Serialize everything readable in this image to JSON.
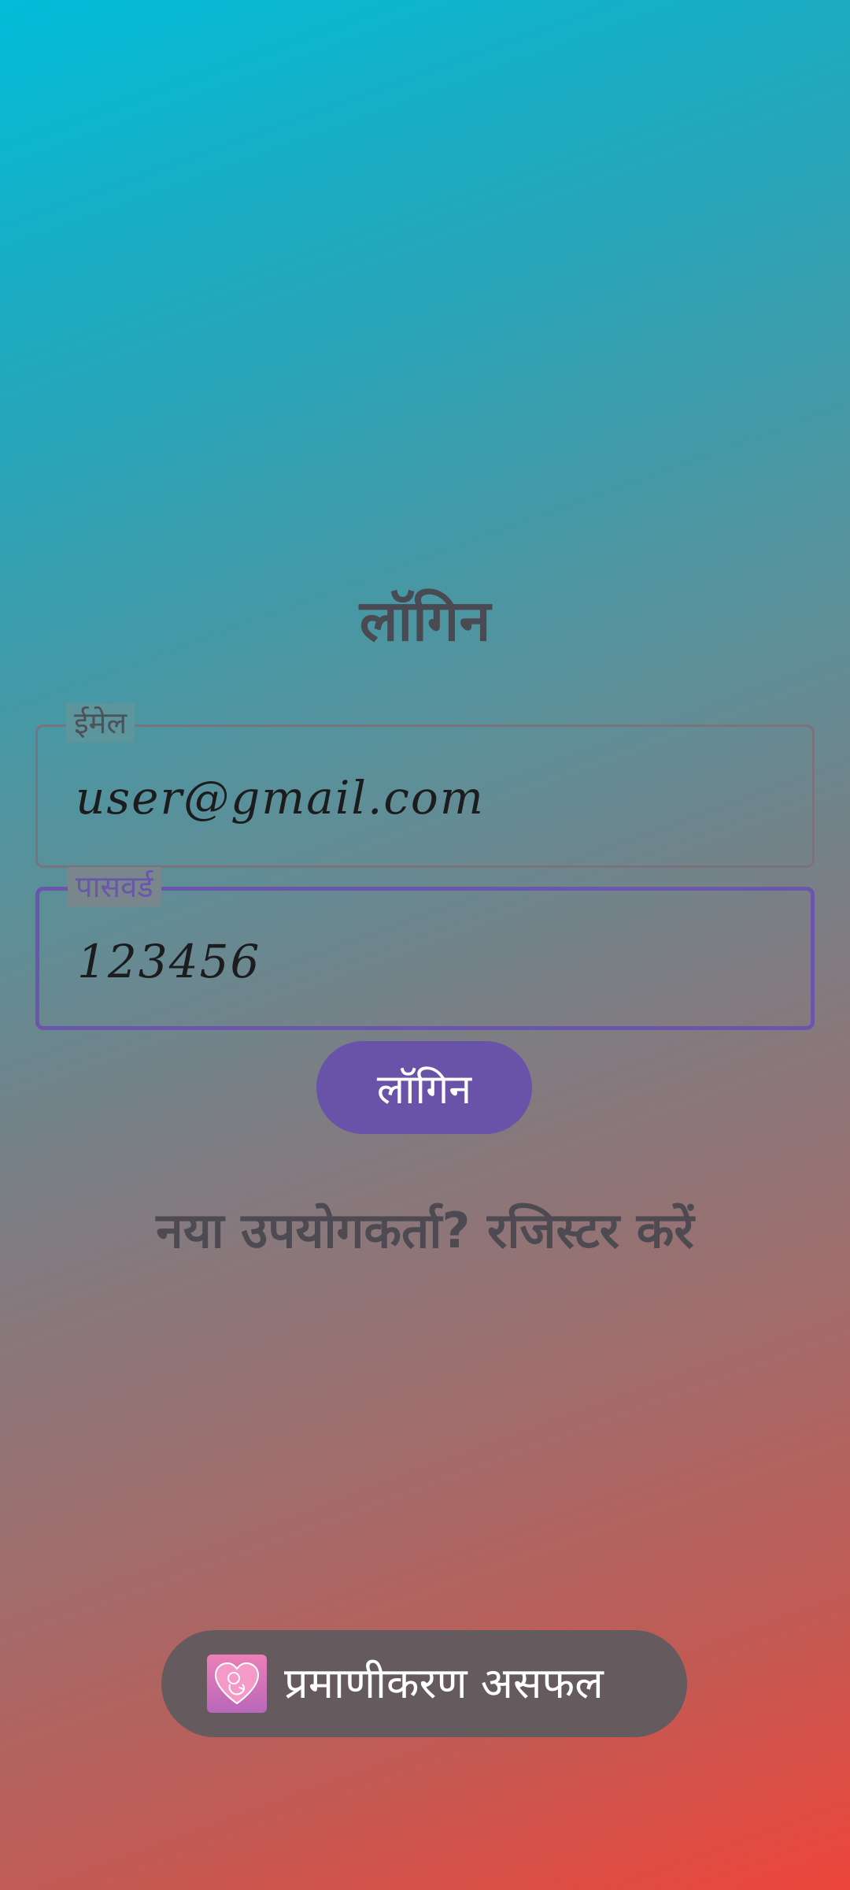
{
  "page": {
    "title": "लॉगिन"
  },
  "form": {
    "email": {
      "label": "ईमेल",
      "value": "user@gmail.com"
    },
    "password": {
      "label": "पासवर्ड",
      "value": "123456"
    },
    "login_button": "लॉगिन",
    "register_link": "नया उपयोगकर्ता? रजिस्टर करें"
  },
  "toast": {
    "icon": "heart-baby-icon",
    "message": "प्रमाणीकरण असफल"
  },
  "colors": {
    "gradient_top": "#02bcd8",
    "gradient_bottom": "#ee463b",
    "accent": "#6853a9",
    "toast_bg": "#655a5d"
  }
}
